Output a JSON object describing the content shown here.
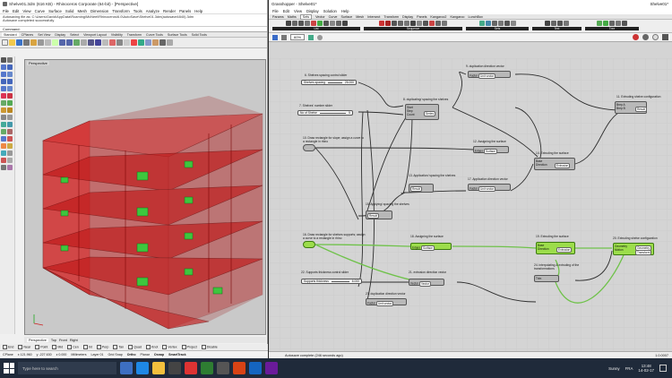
{
  "rhino": {
    "title": "Shelve01.3dm (616 KB) - Rhinoceros Corporate (64-bit) - [Perspective]",
    "menu": [
      "File",
      "Edit",
      "View",
      "Curve",
      "Surface",
      "Solid",
      "Mesh",
      "Dimension",
      "Transform",
      "Tools",
      "Analyze",
      "Render",
      "Panels",
      "Help"
    ],
    "history": [
      "Autosaving file as: C:\\Users\\Gavid\\AppData\\Roaming\\McNeel\\Rhinoceros\\6.0\\AutoSave\\Shelve01.3dm(autosave4840).3dm",
      "Autosave completed successfully"
    ],
    "command_label": "Command:",
    "toolbar_tabs": [
      "Standard",
      "CPlanes",
      "Set View",
      "Display",
      "Select",
      "Viewport Layout",
      "Visibility",
      "Transform",
      "Curve Tools",
      "Surface Tools",
      "Solid Tools"
    ],
    "viewport_label": "Perspective",
    "viewport_tabs": [
      "Perspective",
      "Top",
      "Front",
      "Right"
    ],
    "osnaps": [
      "End",
      "Near",
      "Point",
      "Mid",
      "Cen",
      "Int",
      "Perp",
      "Tan",
      "Quad",
      "Knot",
      "Vertex",
      "Project",
      "Disable"
    ],
    "status": {
      "cplane": "CPlane",
      "x": "x 121.960",
      "y": "y -227.630",
      "z": "z 0.000",
      "units": "Millimeters",
      "layer": "Layer 01",
      "items": [
        "Grid Snap",
        "Ortho",
        "Planar",
        "Osnap",
        "SmartTrack",
        "Gumball"
      ]
    }
  },
  "gh": {
    "title": "Grasshopper - Shelve01*",
    "title_right": "Shelve01*",
    "menu": [
      "File",
      "Edit",
      "View",
      "Display",
      "Solution",
      "Help"
    ],
    "tabs": [
      "Params",
      "Maths",
      "Sets",
      "Vector",
      "Curve",
      "Surface",
      "Mesh",
      "Intersect",
      "Transform",
      "Display",
      "Panels",
      "Kangaroo2",
      "Kangaroo",
      "LunchBox"
    ],
    "active_tab": "Sets",
    "ribbon_groups": [
      "List",
      "Sequence",
      "Sets",
      "Text",
      "Tree"
    ],
    "zoom": "60%",
    "status_text": "Autosave complete (246 seconds ago)",
    "version": "1.0.0007"
  },
  "nodes": {
    "g6": "6. Shelves spacing control slider",
    "g6_slider_label": "Shelves spacing",
    "g6_slider_value": "26.000",
    "g7": "7. Shelves' number slider",
    "g7_slider_label": "No of Shelve",
    "g7_slider_value": "5",
    "g8": "8. duplicating/ spacing the shelves",
    "g9": "9. duplication direction vector",
    "g10": "10. Draw rectangle for slope; assign a curve to a rectangle in rhino",
    "g11": "11. Extruding shelve configuration",
    "g12": "12. Assigning the surface",
    "g13": "13. Application/ spacing the shelves",
    "g14": "14. Extruding the surface",
    "g15": "15. Applying/ spacing the shelves",
    "g16": "16. Draw rectangle for shelves supports; assign a curve to a rectangle in rhino",
    "g17": "17. Application direction vector",
    "g18": "18. Assigning the surface",
    "g19": "19. Extruding the surface",
    "g20": "20. Extruding shelve configuration",
    "g21": "21. extrusion direction vector",
    "g22": "22. Supports thickness control slider",
    "g22_slider_label": "Supports thickness",
    "g22_slider_value": "6.000",
    "g23": "23. duplication direction vector",
    "g24": "24. interpolating & extruding of the transformations",
    "series": "Series",
    "unit_vector": "Unit vector",
    "start": "Start",
    "step": "Step",
    "count": "Count",
    "result": "Result",
    "brep": "Brep",
    "surface": "Surface",
    "edges": "Edges",
    "base": "Base",
    "direction": "Direction",
    "extrusion": "Extrusion",
    "geometry": "Geometry",
    "motion": "Motion",
    "transform": "Transform",
    "factor": "Factor",
    "vector": "Vector",
    "a": "Brep A",
    "b": "Brep B",
    "trim": "Trim"
  },
  "taskbar": {
    "search": "Type here to search",
    "weather": "Sunny",
    "lang": "FRA",
    "time": "13:48",
    "date": "14-02-17"
  }
}
